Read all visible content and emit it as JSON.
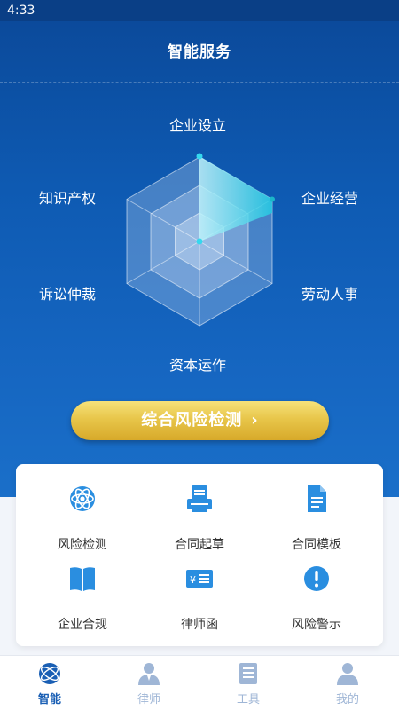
{
  "status_bar": {
    "time": "4:33"
  },
  "header": {
    "title": "智能服务"
  },
  "radar": {
    "axes": [
      "企业设立",
      "企业经营",
      "劳动人事",
      "资本运作",
      "诉讼仲裁",
      "知识产权"
    ],
    "levels": 3,
    "highlighted_axes": [
      "企业设立",
      "企业经营"
    ],
    "colors": {
      "fill": "#d6e6f7",
      "line": "#ffffff",
      "highlight": "#2fd3e8"
    }
  },
  "cta": {
    "label": "综合风险检测",
    "arrow": "›"
  },
  "services": [
    {
      "label": "风险检测",
      "icon": "atom-icon"
    },
    {
      "label": "合同起草",
      "icon": "printer-icon"
    },
    {
      "label": "合同模板",
      "icon": "document-icon"
    },
    {
      "label": "企业合规",
      "icon": "book-icon"
    },
    {
      "label": "律师函",
      "icon": "letter-icon"
    },
    {
      "label": "风险警示",
      "icon": "alert-icon"
    }
  ],
  "tabbar": {
    "items": [
      {
        "label": "智能",
        "icon": "globe-icon",
        "active": true
      },
      {
        "label": "律师",
        "icon": "lawyer-icon",
        "active": false
      },
      {
        "label": "工具",
        "icon": "toolbox-icon",
        "active": false
      },
      {
        "label": "我的",
        "icon": "profile-icon",
        "active": false
      }
    ]
  },
  "colors": {
    "primary": "#1565c0",
    "accent_gold": "#e8c64a",
    "icon_blue": "#2a8ee0"
  }
}
